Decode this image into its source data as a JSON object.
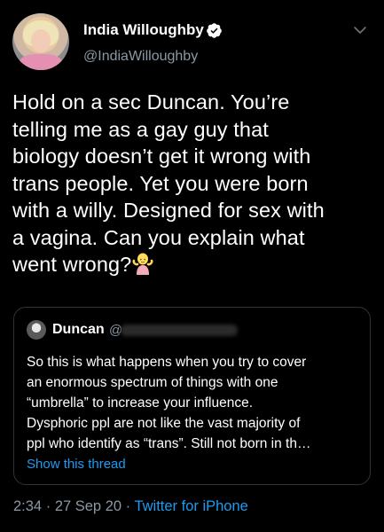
{
  "author": {
    "display_name": "India Willoughby",
    "handle": "@IndiaWilloughby",
    "verified": true
  },
  "tweet": {
    "lines": [
      "Hold on a sec Duncan. You’re",
      "telling me as a gay guy that",
      "biology doesn’t get it wrong with",
      "trans people. Yet you were born",
      "with a willy. Designed for sex with",
      "a vagina. Can you explain what",
      "went wrong?"
    ],
    "emoji": "woman-shrugging-emoji"
  },
  "quoted_tweet": {
    "name": "Duncan",
    "handle_visible": "@",
    "lines": [
      "So this is what happens when you try to cover",
      "an enormous spectrum of things with one",
      "“umbrella” to increase your influence.",
      "Dysphoric ppl are not like the vast majority of",
      "ppl who identify as “trans”. Still not born in th…"
    ],
    "show_thread_label": "Show this thread"
  },
  "meta": {
    "time": "2:34",
    "separator": "·",
    "date": "27 Sep 20",
    "source": "Twitter for iPhone"
  },
  "colors": {
    "background": "#000000",
    "text": "#ffffff",
    "secondary": "#8b98a5",
    "link": "#1d9bf0",
    "border": "#2f3336"
  }
}
